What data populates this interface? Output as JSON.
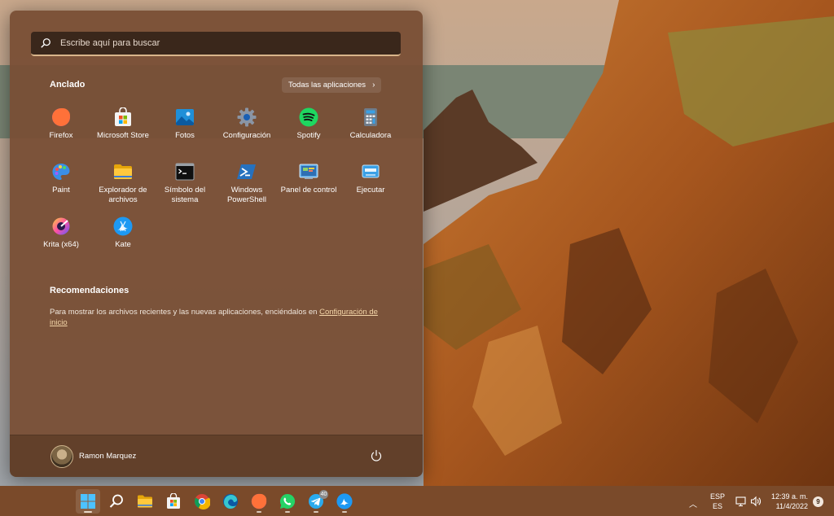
{
  "search": {
    "placeholder": "Escribe aquí para buscar"
  },
  "pinned": {
    "heading": "Anclado",
    "all_apps_label": "Todas las aplicaciones",
    "apps": [
      {
        "label": "Firefox",
        "icon": "firefox-icon"
      },
      {
        "label": "Microsoft Store",
        "icon": "microsoft-store-icon"
      },
      {
        "label": "Fotos",
        "icon": "photos-icon"
      },
      {
        "label": "Configuración",
        "icon": "settings-gear-icon"
      },
      {
        "label": "Spotify",
        "icon": "spotify-icon"
      },
      {
        "label": "Calculadora",
        "icon": "calculator-icon"
      },
      {
        "label": "Paint",
        "icon": "paint-palette-icon"
      },
      {
        "label": "Explorador de archivos",
        "icon": "folder-icon"
      },
      {
        "label": "Símbolo del sistema",
        "icon": "command-prompt-icon"
      },
      {
        "label": "Windows PowerShell",
        "icon": "powershell-icon"
      },
      {
        "label": "Panel de control",
        "icon": "control-panel-icon"
      },
      {
        "label": "Ejecutar",
        "icon": "run-icon"
      },
      {
        "label": "Krita (x64)",
        "icon": "krita-icon"
      },
      {
        "label": "Kate",
        "icon": "kate-icon"
      }
    ]
  },
  "recommendations": {
    "heading": "Recomendaciones",
    "text": "Para mostrar los archivos recientes y las nuevas aplicaciones, enciéndalos en ",
    "link": "Configuración de inicio"
  },
  "user": {
    "name": "Ramon Marquez"
  },
  "taskbar": {
    "items": [
      "start-icon",
      "search-icon",
      "file-explorer-icon",
      "microsoft-store-icon",
      "chrome-icon",
      "edge-icon",
      "firefox-icon",
      "whatsapp-icon",
      "telegram-icon",
      "kate-icon"
    ],
    "telegram_badge": "40",
    "language": {
      "line1": "ESP",
      "line2": "ES"
    },
    "clock": {
      "time": "12:39 a. m.",
      "date": "11/4/2022"
    },
    "notification_count": "9"
  },
  "colors": {
    "menu_bg": "#784e34",
    "taskbar_bg": "#7a4a2a",
    "search_accent": "#d9b58a"
  }
}
